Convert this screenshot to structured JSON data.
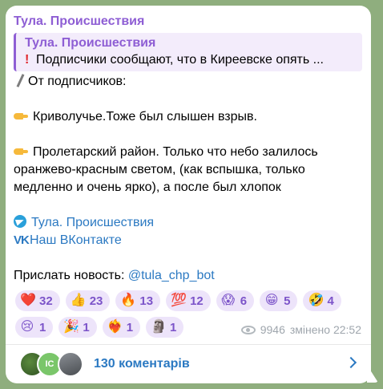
{
  "post": {
    "sender": "Тула. Происшествия",
    "reply": {
      "title": "Тула. Происшествия",
      "text": "Подписчики сообщают, что в Киреевске опять ..."
    },
    "lines": [
      "От подписчиков:",
      "",
      "Криволучье.Тоже был слышен взрыв.",
      "",
      "Пролетарский район. Только что небо залилось",
      "оранжево-красным светом, (как вспышка, только",
      "медленно и очень ярко), а после был хлопок",
      "",
      "Тула. Происшествия",
      "Наш ВКонтакте",
      "",
      "Прислать новость: ",
      "@tula_chp_bot"
    ]
  },
  "reactions": [
    {
      "emoji": "❤️",
      "count": "32"
    },
    {
      "emoji": "👍",
      "count": "23"
    },
    {
      "emoji": "🔥",
      "count": "13"
    },
    {
      "emoji": "💯",
      "count": "12"
    },
    {
      "emoji": "😱",
      "count": "6"
    },
    {
      "emoji": "😁",
      "count": "5"
    },
    {
      "emoji": "🤣",
      "count": "4"
    },
    {
      "emoji": "😢",
      "count": "1"
    },
    {
      "emoji": "🎉",
      "count": "1"
    },
    {
      "emoji": "❤️‍🔥",
      "count": "1"
    },
    {
      "emoji": "🗿",
      "count": "1"
    }
  ],
  "meta": {
    "views": "9946",
    "edited": "змінено 22:52"
  },
  "comments": {
    "avatar_initials": "IC",
    "label": "130 коментарів"
  },
  "colors": {
    "accent": "#8e5ed4",
    "link": "#2b79c2",
    "background": "#8fae7e"
  }
}
